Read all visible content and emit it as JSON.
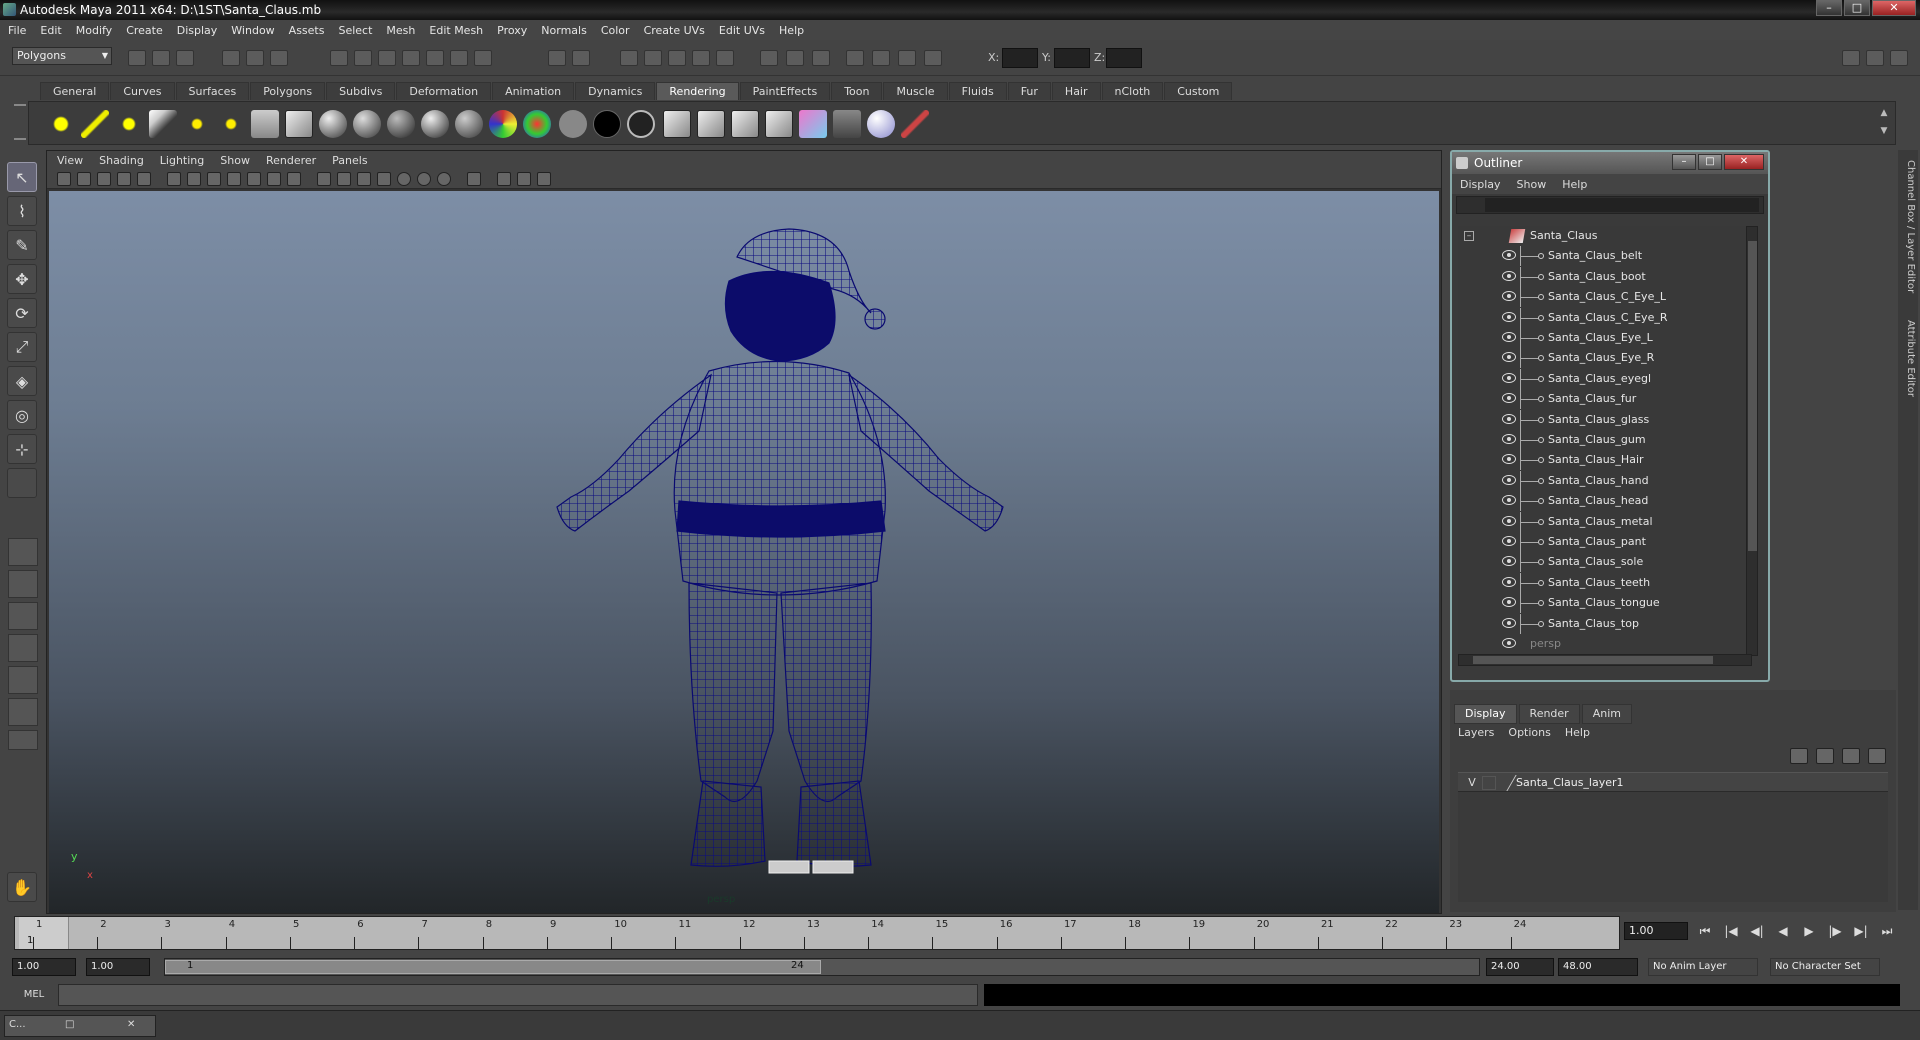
{
  "window": {
    "title": "Autodesk Maya 2011 x64: D:\\1ST\\Santa_Claus.mb",
    "buttons": [
      "–",
      "□",
      "✕"
    ]
  },
  "menubar": [
    "File",
    "Edit",
    "Modify",
    "Create",
    "Display",
    "Window",
    "Assets",
    "Select",
    "Mesh",
    "Edit Mesh",
    "Proxy",
    "Normals",
    "Color",
    "Create UVs",
    "Edit UVs",
    "Help"
  ],
  "statusline": {
    "mode": "Polygons",
    "x_label": "X:",
    "y_label": "Y:",
    "z_label": "Z:"
  },
  "shelf": {
    "tabs": [
      "General",
      "Curves",
      "Surfaces",
      "Polygons",
      "Subdivs",
      "Deformation",
      "Animation",
      "Dynamics",
      "Rendering",
      "PaintEffects",
      "Toon",
      "Muscle",
      "Fluids",
      "Fur",
      "Hair",
      "nCloth",
      "Custom"
    ],
    "active_tab": "Rendering"
  },
  "viewport": {
    "menu": [
      "View",
      "Shading",
      "Lighting",
      "Show",
      "Renderer",
      "Panels"
    ],
    "camera_label": "persp",
    "axis_y": "y",
    "axis_x": "x",
    "wireframe_color": "#0a0a7a"
  },
  "outliner": {
    "title": "Outliner",
    "menu": [
      "Display",
      "Show",
      "Help"
    ],
    "root": "Santa_Claus",
    "children": [
      "Santa_Claus_belt",
      "Santa_Claus_boot",
      "Santa_Claus_C_Eye_L",
      "Santa_Claus_C_Eye_R",
      "Santa_Claus_Eye_L",
      "Santa_Claus_Eye_R",
      "Santa_Claus_eyegl",
      "Santa_Claus_fur",
      "Santa_Claus_glass",
      "Santa_Claus_gum",
      "Santa_Claus_Hair",
      "Santa_Claus_hand",
      "Santa_Claus_head",
      "Santa_Claus_metal",
      "Santa_Claus_pant",
      "Santa_Claus_sole",
      "Santa_Claus_teeth",
      "Santa_Claus_tongue",
      "Santa_Claus_top"
    ],
    "trailing": "persp",
    "expander": "–"
  },
  "layer_editor": {
    "tabs": [
      "Display",
      "Render",
      "Anim"
    ],
    "active_tab": "Display",
    "menu": [
      "Layers",
      "Options",
      "Help"
    ],
    "layer": {
      "visible": "V",
      "name": "Santa_Claus_layer1"
    }
  },
  "side_tabs": [
    "Channel Box / Layer Editor",
    "Attribute Editor"
  ],
  "timeline": {
    "frames": [
      "1",
      "2",
      "3",
      "4",
      "5",
      "6",
      "7",
      "8",
      "9",
      "10",
      "11",
      "12",
      "13",
      "14",
      "15",
      "16",
      "17",
      "18",
      "19",
      "20",
      "21",
      "22",
      "23",
      "24"
    ],
    "current_frame": "1",
    "current_field": "1.00",
    "playback": [
      "⏮",
      "|◀",
      "◀|",
      "◀",
      "▶",
      "|▶",
      "▶|",
      "⏭"
    ]
  },
  "range": {
    "start_time": "1.00",
    "playback_start": "1.00",
    "bar_start": "1",
    "bar_end": "24",
    "playback_end": "24.00",
    "end_time": "48.00",
    "anim_layer": "No Anim Layer",
    "character_set": "No Character Set"
  },
  "cmdline": {
    "label": "MEL"
  },
  "helpline": {
    "mini_label": "C..."
  },
  "colors": {
    "viewport_top": "#7d8ea6",
    "viewport_bottom": "#222629",
    "accent_active_tab": "#5a5a5a",
    "outliner_frame": "#8aa"
  }
}
